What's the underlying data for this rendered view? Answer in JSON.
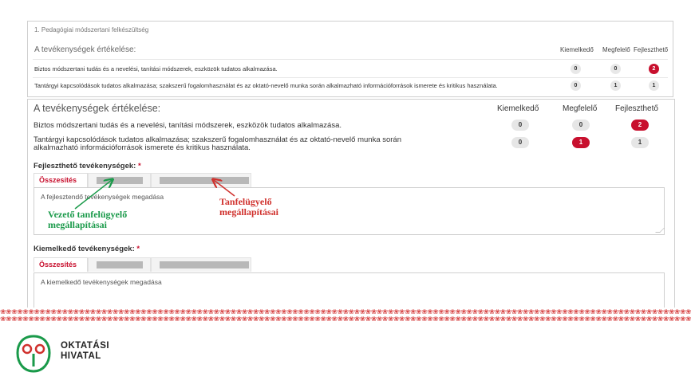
{
  "top_panel": {
    "breadcrumb": "1. Pedagógiai módszertani felkészültség",
    "title": "A tevékenységek értékelése:",
    "headers": [
      "Kiemelkedő",
      "Megfelelő",
      "Fejleszthető"
    ],
    "rows": [
      {
        "text": "Biztos módszertani tudás és a nevelési, tanítási módszerek, eszközök tudatos alkalmazása.",
        "values": [
          "0",
          "0",
          "2"
        ]
      },
      {
        "text": "Tantárgyi kapcsolódások tudatos alkalmazása; szakszerű fogalomhasználat és az oktató-nevelő munka során alkalmazható információforrások ismerete és kritikus használata.",
        "values": [
          "0",
          "1",
          "1"
        ]
      }
    ]
  },
  "main_panel": {
    "title": "A tevékenységek értékelése:",
    "headers": [
      "Kiemelkedő",
      "Megfelelő",
      "Fejleszthető"
    ],
    "rows": [
      {
        "text_line1": "Biztos módszertani tudás és a nevelési, tanítási módszerek, eszközök tudatos alkalmazása.",
        "text_line2": "",
        "values": [
          "0",
          "0",
          "2"
        ]
      },
      {
        "text_line1": "Tantárgyi kapcsolódások tudatos alkalmazása; szakszerű fogalomhasználat és az oktató-nevelő munka során",
        "text_line2": "alkalmazható információforrások ismerete és kritikus használata.",
        "values": [
          "0",
          "1",
          "1"
        ]
      }
    ],
    "develop": {
      "label": "Fejleszthető tevékenységek:",
      "required": "*",
      "tab_summary": "Összesítés",
      "placeholder": "A fejlesztendő tevékenységek megadása"
    },
    "excellent": {
      "label": "Kiemelkedő tevékenységek:",
      "required": "*",
      "tab_summary": "Összesítés",
      "placeholder": "A kiemelkedő tevékenységek megadása"
    }
  },
  "annotations": {
    "green_line1": "Vezető tanfelügyelő",
    "green_line2": "megállapításai",
    "red_line1": "Tanfelügyelő",
    "red_line2": "megállapításai",
    "green_color": "#1a9a4a",
    "red_color": "#d0312d"
  },
  "logo": {
    "line1": "OKTATÁSI",
    "line2": "HIVATAL",
    "icon": "owl-icon"
  },
  "colors": {
    "accent": "#c8102e",
    "badge_gray": "#e6e6e6"
  }
}
